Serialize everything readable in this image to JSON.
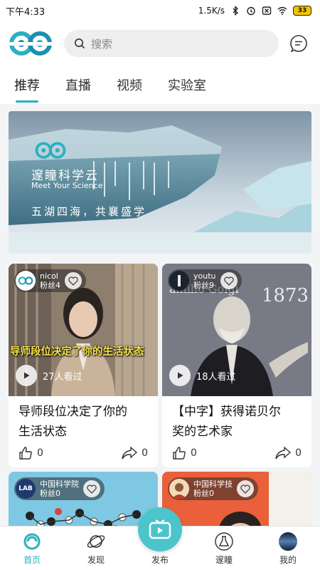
{
  "status_bar": {
    "time": "下午4:33",
    "network_speed": "1.5K/s",
    "battery": "33"
  },
  "header": {
    "search_placeholder": "搜索"
  },
  "tabs": [
    {
      "label": "推荐",
      "active": true
    },
    {
      "label": "直播",
      "active": false
    },
    {
      "label": "视频",
      "active": false
    },
    {
      "label": "实验室",
      "active": false
    }
  ],
  "banner": {
    "brand": "邃瞳科学云",
    "brand_en": "Meet Your Science",
    "slogan": "五湖四海，共襄盛学"
  },
  "cards": [
    {
      "author": "nicol",
      "fans": "粉丝4",
      "overlay_text": "导师段位决定了你的生活状态",
      "views": "27人看过",
      "title_line1": "导师段位决定了你的",
      "title_line2": "生活状态",
      "likes": "0",
      "shares": "0"
    },
    {
      "author": "youtu",
      "fans": "粉丝9",
      "thumb_caption": "amillo Golgi",
      "thumb_year": "1873",
      "views": "18人看过",
      "title_line1": "【中字】获得诺贝尔",
      "title_line2": "奖的艺术家",
      "likes": "0",
      "shares": "0"
    },
    {
      "author": "中国科学院",
      "fans": "粉丝0",
      "avatar_text": "LAB"
    },
    {
      "author": "中国科学技",
      "fans": "粉丝0"
    }
  ],
  "bottom_nav": [
    {
      "label": "首页",
      "active": true
    },
    {
      "label": "发现",
      "active": false
    },
    {
      "label": "发布",
      "active": false
    },
    {
      "label": "邃瞳",
      "active": false
    },
    {
      "label": "我的",
      "active": false
    }
  ],
  "colors": {
    "accent": "#2ab0c0",
    "publish": "#4cc4cc",
    "overlay_text": "#f7e34a"
  }
}
